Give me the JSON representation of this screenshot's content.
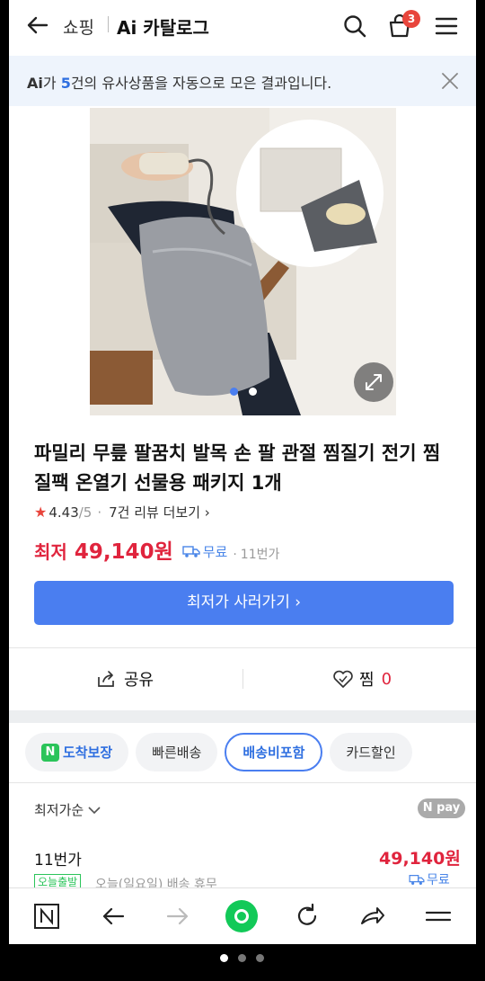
{
  "header": {
    "breadcrumb_shop": "쇼핑",
    "title": "Ai 카탈로그",
    "cart_count": "3",
    "icons": [
      "back-arrow-icon",
      "close-icon",
      "search-icon",
      "cart-icon",
      "menu-icon"
    ]
  },
  "ai_banner": {
    "mark": "Ai",
    "prefix": "가 ",
    "count": "5",
    "suffix": "건의 유사상품을 자동으로 모은 결과입니다."
  },
  "product": {
    "title": "파밀리 무릎 팔꿈치 발목 손 팔 관절 찜질기 전기 찜질팩 온열기 선물용 패키지 1개",
    "rating": "4.43",
    "rating_max": "/5",
    "review_link": "7건 리뷰 더보기",
    "price_label": "최저",
    "price": "49,140원",
    "shipping": "무료",
    "seller": "11번가",
    "buy_button": "최저가 사러가기",
    "image_pages": 2,
    "image_active_page": 1
  },
  "actions": {
    "share": "공유",
    "wish": "찜",
    "wish_count": "0"
  },
  "filters": {
    "chips": [
      "도착보장",
      "빠른배송",
      "배송비포함",
      "카드할인"
    ],
    "active": "배송비포함"
  },
  "offers": {
    "sort_label": "최저가순",
    "pay_badge": "pay",
    "first": {
      "seller": "11번가",
      "price": "49,140원",
      "shipping": "무료",
      "badge": "오늘출발",
      "note": "오늘(일요일) 배송 휴무"
    }
  },
  "bottom_bar": {
    "icons": [
      "naver-home-icon",
      "back-icon",
      "forward-icon",
      "green-dot-icon",
      "refresh-icon",
      "share-icon",
      "menu-icon"
    ]
  },
  "colors": {
    "accent": "#4a7ef0",
    "price": "#e0243d",
    "green": "#2bc45a"
  }
}
